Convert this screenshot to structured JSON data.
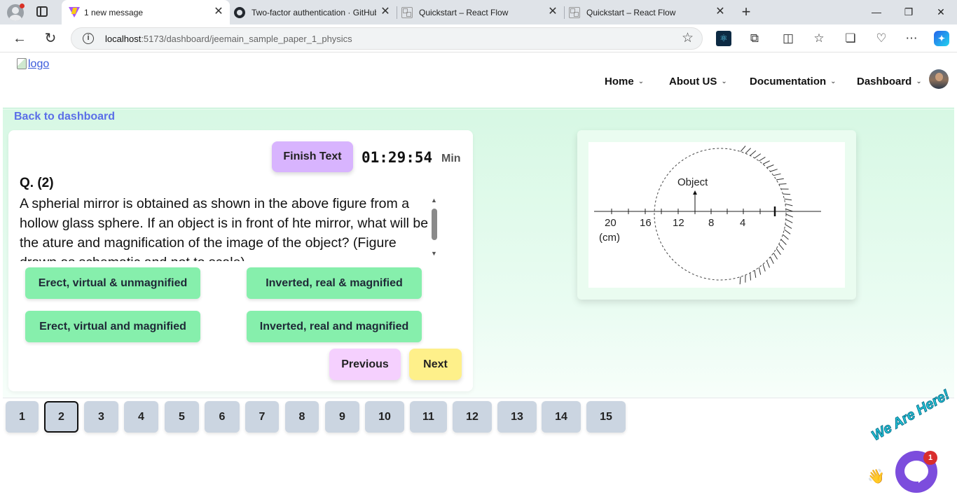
{
  "browser": {
    "tabs": [
      {
        "title": "1 new message",
        "favicon": "vite-icon",
        "active": true
      },
      {
        "title": "Two-factor authentication · GitHub",
        "favicon": "github-icon",
        "active": false
      },
      {
        "title": "Quickstart – React Flow",
        "favicon": "react-flow-icon",
        "active": false
      },
      {
        "title": "Quickstart – React Flow",
        "favicon": "react-flow-icon",
        "active": false
      }
    ],
    "close_glyph": "✕",
    "new_tab_glyph": "+",
    "window_controls": {
      "minimize": "—",
      "restore": "❐",
      "close": "✕"
    },
    "url_host": "localhost",
    "url_path": ":5173/dashboard/jeemain_sample_paper_1_physics",
    "back_glyph": "←",
    "refresh_glyph": "↻",
    "star_glyph": "☆"
  },
  "header": {
    "logo_alt": "logo",
    "nav": [
      {
        "label": "Home"
      },
      {
        "label": "About US"
      },
      {
        "label": "Documentation"
      },
      {
        "label": "Dashboard"
      }
    ],
    "chevron": "⌄"
  },
  "content": {
    "back_link": "Back to dashboard",
    "finish_label": "Finish Text",
    "timer": "01:29:54",
    "timer_unit": "Min",
    "question_number": "Q. (2)",
    "question_text": "A spherial mirror is obtained as shown in the above figure from a hollow glass sphere. If an object is in front of hte mirror, what will be the ature and magnification of the image of the object? (Figure drawn as schematic and not to scale)",
    "options": [
      "Erect, virtual & unmagnified",
      "Inverted, real & magnified",
      "Erect, virtual and magnified",
      "Inverted, real and magnified"
    ],
    "previous_label": "Previous",
    "next_label": "Next",
    "scroll_up": "▲",
    "scroll_down": "▼"
  },
  "figure": {
    "object_label": "Object",
    "scale_labels": [
      "20",
      "16",
      "12",
      "8",
      "4"
    ],
    "unit_label": "(cm)"
  },
  "pagination": {
    "pages": [
      "1",
      "2",
      "3",
      "4",
      "5",
      "6",
      "7",
      "8",
      "9",
      "10",
      "11",
      "12",
      "13",
      "14",
      "15"
    ],
    "current": "2"
  },
  "chat": {
    "banner": "We Are Here!",
    "badge_count": "1",
    "hand": "👋"
  },
  "colors": {
    "option_green": "#86efac",
    "finish_purple": "#d8b4fe",
    "previous_pink": "#f5d0fe",
    "next_yellow": "#fef08a",
    "page_button": "#cbd5e1",
    "back_link": "#5b6fe8",
    "chat_purple": "#7c4ddd"
  }
}
